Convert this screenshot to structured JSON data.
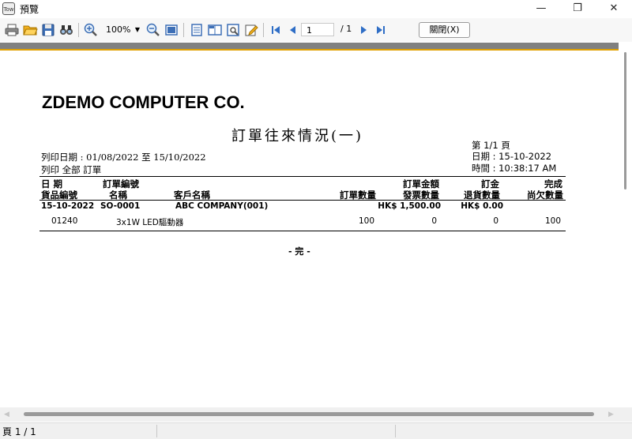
{
  "window": {
    "title": "預覽",
    "app_icon": "Tow",
    "controls": {
      "minimize": "—",
      "maximize": "❐",
      "close": "✕"
    }
  },
  "toolbar": {
    "zoom": "100%",
    "page_current": "1",
    "page_total": "/ 1",
    "close_label": "關閉(X)"
  },
  "report": {
    "company": "ZDEMO COMPUTER CO.",
    "title": "訂單往來情況(一)",
    "print_date_range": "列印日期 : 01/08/2022 至 15/10/2022",
    "print_scope": "列印 全部 訂單",
    "page_info": "第 1/1 頁",
    "date": "日期 : 15-10-2022",
    "time": "時間 : 10:38:17 AM",
    "headers": {
      "date": "日 期",
      "order_no": "訂單編號",
      "item_no": "貨品編號",
      "name": "名稱",
      "customer": "客戶名稱",
      "order_qty": "訂單數量",
      "order_amount": "訂單金額",
      "invoice_qty": "發票數量",
      "deposit": "訂金",
      "return_qty": "退貨數量",
      "complete": "完成",
      "outstanding_qty": "尚欠數量"
    },
    "order": {
      "date": "15-10-2022",
      "order_no": "SO-0001",
      "customer": "ABC COMPANY(001)",
      "amount": "HK$ 1,500.00",
      "deposit": "HK$ 0.00"
    },
    "items": [
      {
        "code": "01240",
        "name": "3x1W LED驅動器",
        "order_qty": "100",
        "invoice_qty": "0",
        "return_qty": "0",
        "outstanding_qty": "100"
      }
    ],
    "end_mark": "- 完 -"
  },
  "status": {
    "page": "頁 1 / 1"
  }
}
